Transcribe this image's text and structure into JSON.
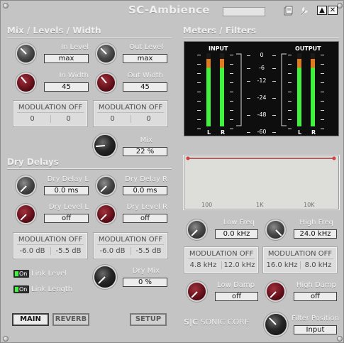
{
  "window": {
    "title": "SC-Ambience",
    "minimize_glyph": "▲",
    "close_glyph": "✕"
  },
  "icons": [
    "save-icon",
    "wrench-icon"
  ],
  "sections": {
    "mix_levels": "Mix / Levels / Width",
    "dry_delays": "Dry Delays",
    "meters_filters": "Meters / Filters"
  },
  "mix": {
    "in_level": {
      "label": "In Level",
      "value": "max"
    },
    "out_level": {
      "label": "Out Level",
      "value": "max"
    },
    "in_width": {
      "label": "In Width",
      "value": "45"
    },
    "out_width": {
      "label": "Out Width",
      "value": "45"
    },
    "mod_left": {
      "title": "MODULATION OFF",
      "a": "0",
      "b": "0"
    },
    "mod_right": {
      "title": "MODULATION OFF",
      "a": "0",
      "b": "0"
    },
    "mix": {
      "label": "Mix",
      "value": "22 %"
    }
  },
  "delays": {
    "delay_l": {
      "label": "Dry Delay L",
      "value": "0.0 ms"
    },
    "delay_r": {
      "label": "Dry Delay R",
      "value": "0.0 ms"
    },
    "level_l": {
      "label": "Dry Level L",
      "value": "off"
    },
    "level_r": {
      "label": "Dry Level R",
      "value": "off"
    },
    "mod_left": {
      "title": "MODULATION OFF",
      "a": "-6.0 dB",
      "b": "-5.5 dB"
    },
    "mod_right": {
      "title": "MODULATION OFF",
      "a": "-6.0 dB",
      "b": "-5.5 dB"
    },
    "link_level": {
      "label": "Link Level",
      "button": "On"
    },
    "link_length": {
      "label": "Link Length",
      "button": "On"
    },
    "dry_mix": {
      "label": "Dry Mix",
      "value": "0 %"
    }
  },
  "tabs": {
    "main": "MAIN",
    "reverb": "REVERB",
    "setup": "SETUP"
  },
  "meters": {
    "input_label": "INPUT",
    "output_label": "OUTPUT",
    "scale": [
      "0",
      "-6",
      "-12",
      "-24",
      "-48",
      "-60"
    ],
    "channels": {
      "l": "L",
      "r": "R"
    },
    "levels": {
      "in_l": 0.92,
      "in_r": 0.92,
      "out_l": 0.92,
      "out_r": 0.92
    }
  },
  "filters": {
    "scale": [
      "100",
      "1K",
      "10K"
    ],
    "low_freq": {
      "label": "Low Freq",
      "value": "0.0 kHz"
    },
    "high_freq": {
      "label": "High Freq",
      "value": "24.0 kHz"
    },
    "mod_left": {
      "title": "MODULATION OFF",
      "a": "4.8 kHz",
      "b": "12.0 kHz"
    },
    "mod_right": {
      "title": "MODULATION OFF",
      "a": "16.0 kHz",
      "b": "8.0 kHz"
    },
    "low_damp": {
      "label": "Low Damp",
      "value": "off"
    },
    "high_damp": {
      "label": "High Damp",
      "value": "off"
    },
    "filter_position": {
      "label": "Filter Position",
      "value": "Input"
    }
  },
  "brand": {
    "logo": "S|C",
    "name": "SONIC CORE"
  },
  "colors": {
    "panel": "#c4c4c4",
    "knob_red": "#64101a",
    "meter_green": "#3ef23e",
    "meter_orange": "#e07b1e"
  }
}
